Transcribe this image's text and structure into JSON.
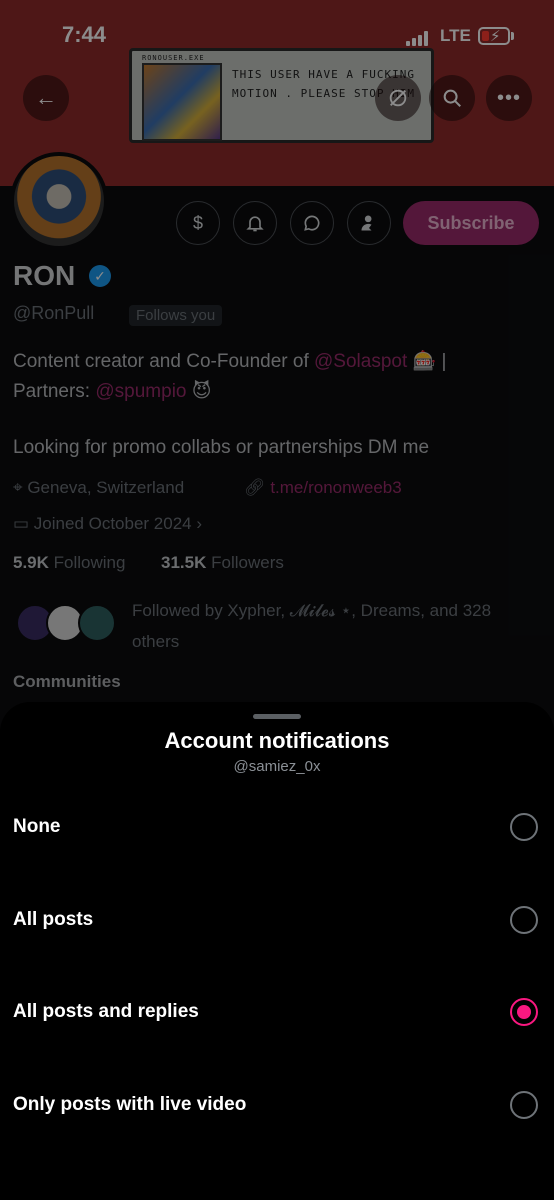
{
  "status_bar": {
    "time": "7:44",
    "network": "LTE"
  },
  "banner": {
    "window_title": "RONOUSER.EXE",
    "message": "THIS USER HAVE A FUCKING MOTION . PLEASE STOP HIM"
  },
  "header": {
    "back_icon": "arrow-left-icon",
    "mute_icon": "no-sync-icon",
    "search_icon": "search-icon",
    "more_icon": "more-horizontal-icon"
  },
  "profile": {
    "name": "RON",
    "handle": "@RonPull",
    "follows_you": "Follows you",
    "subscribe_label": "Subscribe",
    "bio_line1_prefix": "Content creator and Co-Founder of ",
    "bio_mention1": "@Solaspot",
    "bio_line1_suffix": " 🎰 |",
    "bio_line2_prefix": "Partners: ",
    "bio_mention2": "@spumpio",
    "bio_line2_suffix": " 😈",
    "bio_line3": "Looking for promo collabs or partnerships DM me",
    "location": "Geneva, Switzerland",
    "link": "t.me/rononweeb3",
    "joined": "Joined October 2024",
    "following_count": "5.9K",
    "following_label": "Following",
    "followers_count": "31.5K",
    "followers_label": "Followers",
    "followed_by": "Followed by Xypher, 𝓜𝓲𝓵𝓮𝓼 ⋆, Dreams, and 328 others",
    "communities_label": "Communities"
  },
  "sheet": {
    "title": "Account notifications",
    "subtitle": "@samiez_0x",
    "options": [
      {
        "label": "None",
        "selected": false
      },
      {
        "label": "All posts",
        "selected": false
      },
      {
        "label": "All posts and replies",
        "selected": true
      },
      {
        "label": "Only posts with live video",
        "selected": false
      }
    ],
    "accent_color": "#f91880"
  }
}
